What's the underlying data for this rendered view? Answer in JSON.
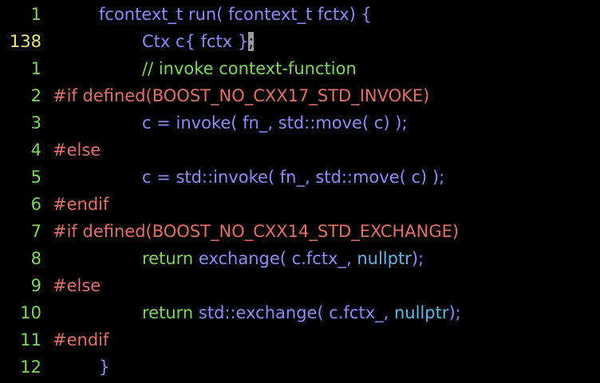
{
  "colors": {
    "background": "#000000",
    "line_number": "#7fd65a",
    "line_number_current": "#f4e87a",
    "code_default": "#8b8cf7",
    "comment": "#7fd65a",
    "preprocessor": "#e2706a",
    "keyword": "#7fd65a",
    "constant": "#5fb8e8",
    "cursor": "#9a9a9a"
  },
  "editor": {
    "lines": [
      {
        "number": "1",
        "current": false,
        "indent": "4",
        "tokens": [
          {
            "text": "fcontext_t run( fcontext_t fctx) {",
            "kind": "default"
          }
        ]
      },
      {
        "number": "138",
        "current": true,
        "indent": "8",
        "tokens": [
          {
            "text": "Ctx c{ fctx }",
            "kind": "default"
          },
          {
            "text": ";",
            "kind": "cursor"
          }
        ]
      },
      {
        "number": "1",
        "current": false,
        "indent": "8",
        "tokens": [
          {
            "text": "// invoke context-function",
            "kind": "comment"
          }
        ]
      },
      {
        "number": "2",
        "current": false,
        "indent": "0",
        "tokens": [
          {
            "text": "#if defined(BOOST_NO_CXX17_STD_INVOKE)",
            "kind": "preproc"
          }
        ]
      },
      {
        "number": "3",
        "current": false,
        "indent": "8",
        "tokens": [
          {
            "text": "c = invoke( fn_, std::move( c) );",
            "kind": "default"
          }
        ]
      },
      {
        "number": "4",
        "current": false,
        "indent": "0",
        "tokens": [
          {
            "text": "#else",
            "kind": "preproc"
          }
        ]
      },
      {
        "number": "5",
        "current": false,
        "indent": "8",
        "tokens": [
          {
            "text": "c = std::invoke( fn_, std::move( c) );",
            "kind": "default"
          }
        ]
      },
      {
        "number": "6",
        "current": false,
        "indent": "0",
        "tokens": [
          {
            "text": "#endif",
            "kind": "preproc"
          }
        ]
      },
      {
        "number": "7",
        "current": false,
        "indent": "0",
        "tokens": [
          {
            "text": "#if defined(BOOST_NO_CXX14_STD_EXCHANGE)",
            "kind": "preproc"
          }
        ]
      },
      {
        "number": "8",
        "current": false,
        "indent": "8",
        "tokens": [
          {
            "text": "return",
            "kind": "keyword"
          },
          {
            "text": " exchange( c.fctx_, ",
            "kind": "default"
          },
          {
            "text": "nullptr",
            "kind": "constant"
          },
          {
            "text": ");",
            "kind": "default"
          }
        ]
      },
      {
        "number": "9",
        "current": false,
        "indent": "0",
        "tokens": [
          {
            "text": "#else",
            "kind": "preproc"
          }
        ]
      },
      {
        "number": "10",
        "current": false,
        "indent": "8",
        "tokens": [
          {
            "text": "return",
            "kind": "keyword"
          },
          {
            "text": " std::exchange( c.fctx_, ",
            "kind": "default"
          },
          {
            "text": "nullptr",
            "kind": "constant"
          },
          {
            "text": ");",
            "kind": "default"
          }
        ]
      },
      {
        "number": "11",
        "current": false,
        "indent": "0",
        "tokens": [
          {
            "text": "#endif",
            "kind": "preproc"
          }
        ]
      },
      {
        "number": "12",
        "current": false,
        "indent": "4",
        "tokens": [
          {
            "text": "}",
            "kind": "default"
          }
        ]
      }
    ]
  }
}
